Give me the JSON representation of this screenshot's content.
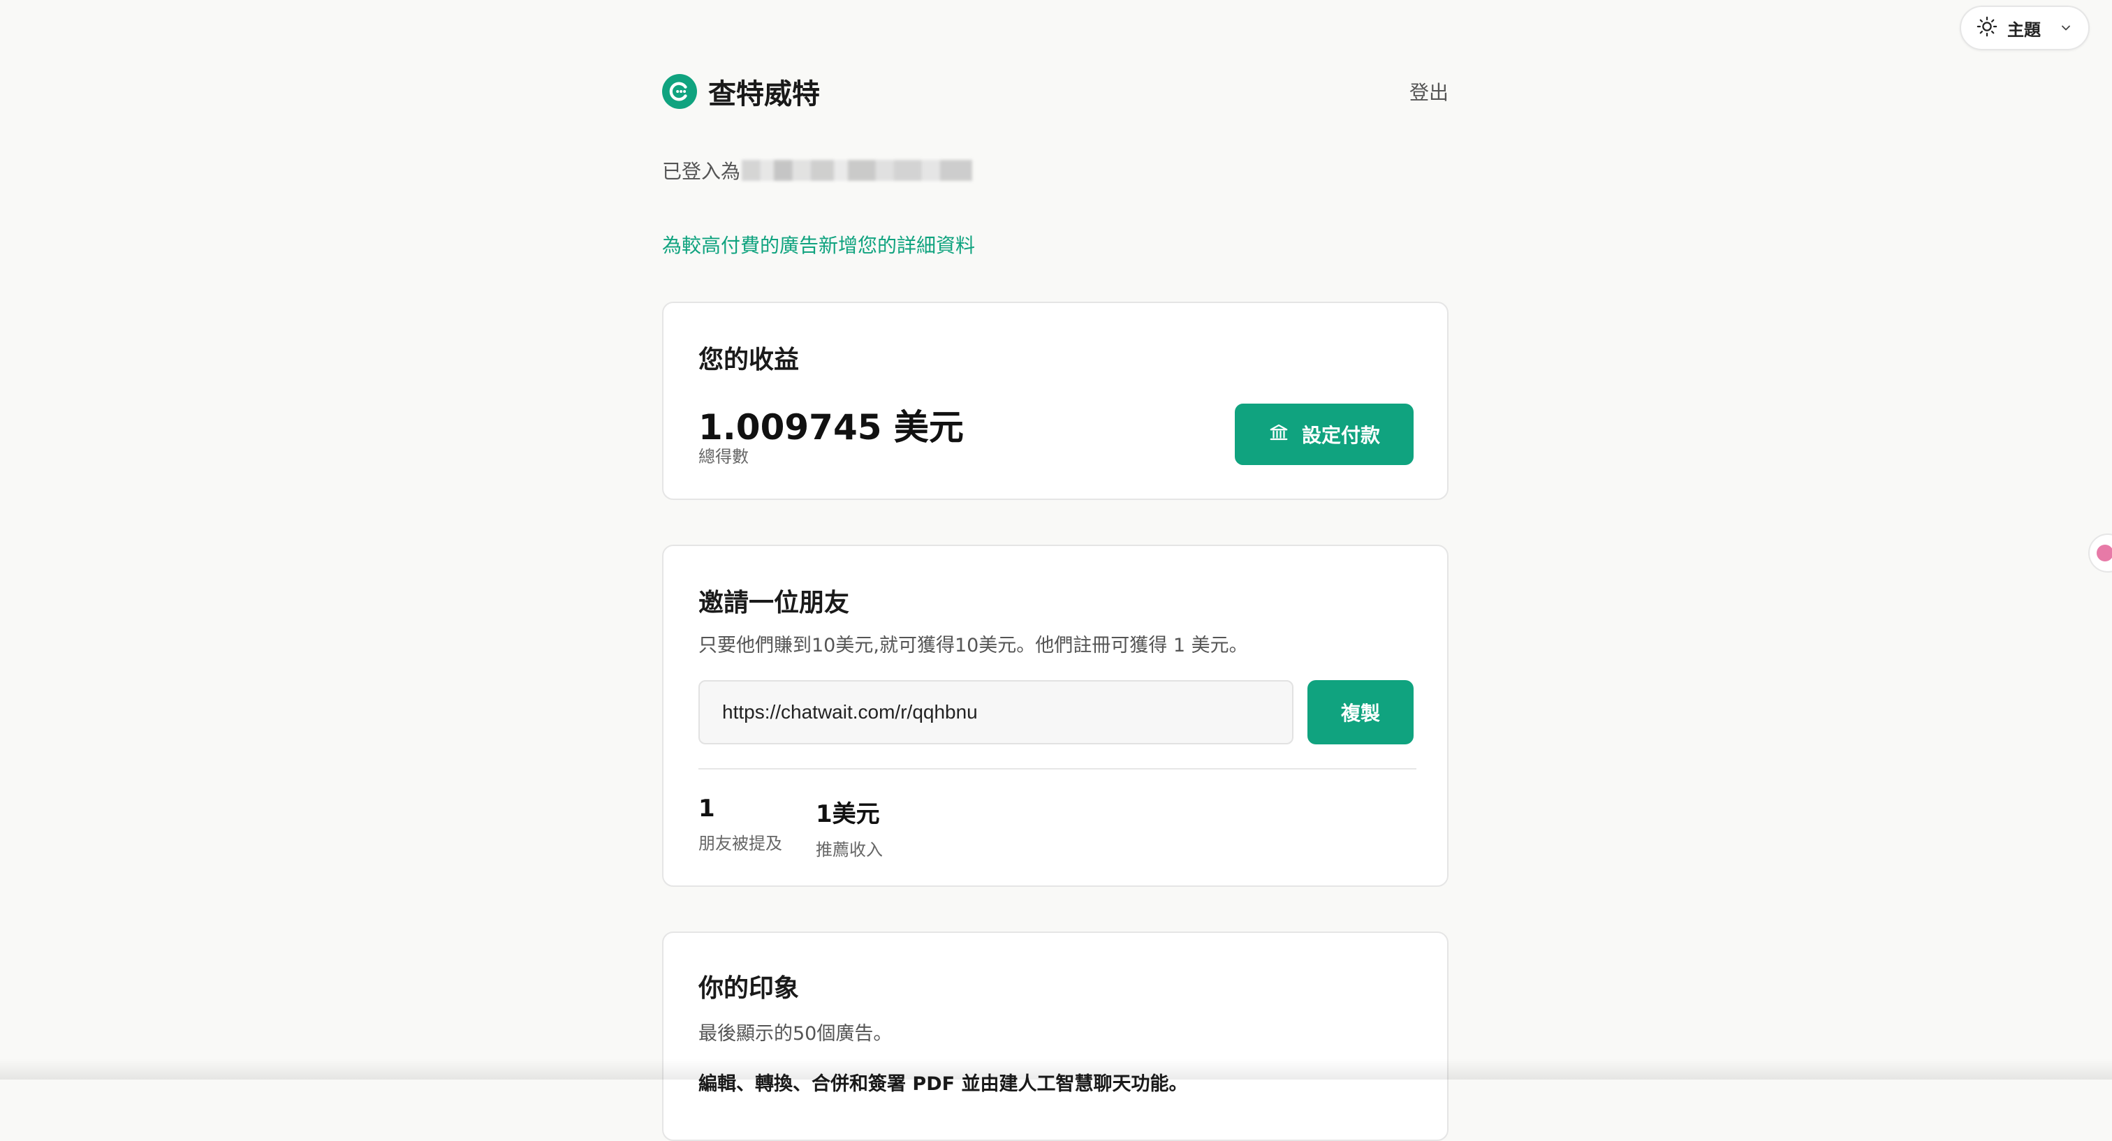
{
  "theme": {
    "label": "主題",
    "icon": "sun-icon"
  },
  "header": {
    "brand": "查特威特",
    "logout": "登出",
    "logo_icon": "chatwait-logo-icon"
  },
  "account": {
    "logged_in_prefix": "已登入為"
  },
  "details_link": "為較高付費的廣告新增您的詳細資料",
  "earnings": {
    "title": "您的收益",
    "amount": "1.009745 美元",
    "amount_label": "總得數",
    "payout_button": "設定付款"
  },
  "invite": {
    "title": "邀請一位朋友",
    "description": "只要他們賺到10美元,就可獲得10美元。他們註冊可獲得 1 美元。",
    "referral_link": "https://chatwait.com/r/qqhbnu",
    "copy_button": "複製",
    "stats": [
      {
        "value": "1",
        "label": "朋友被提及"
      },
      {
        "value": "1美元",
        "label": "推薦收入"
      }
    ]
  },
  "impressions": {
    "title": "你的印象",
    "description": "最後顯示的50個廣告。",
    "first_item": "編輯、轉換、合併和簽署 PDF 並由建人工智慧聊天功能。"
  },
  "colors": {
    "accent": "#10a37f",
    "background": "#f9f9f7"
  }
}
